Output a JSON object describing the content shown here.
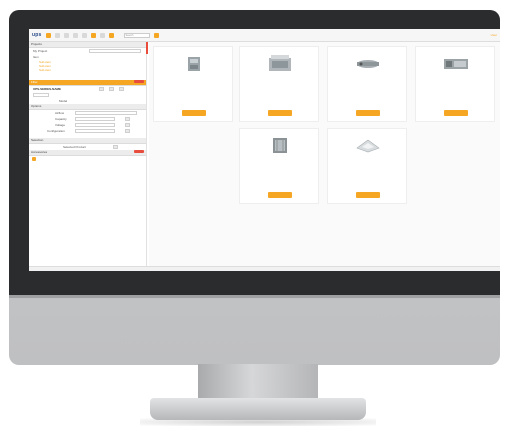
{
  "toolbar": {
    "logo": "ups",
    "icons": [
      "menu-icon",
      "back-icon",
      "forward-icon",
      "doc-icon",
      "folder-icon",
      "tool-icon",
      "chart-icon",
      "settings-icon",
      "help-icon"
    ],
    "search_placeholder": "Search",
    "user": "User"
  },
  "left_panel": {
    "sections": [
      {
        "title": "Projects",
        "rows": [
          "My Project",
          "Item",
          "Sub-item",
          "Sub-item",
          "Sub-item"
        ]
      },
      {
        "title": "Filter",
        "rows": [
          "UPS-SERIES-NAME",
          "Model"
        ]
      },
      {
        "title": "Options",
        "rows": [
          "Airflow",
          "Capacity",
          "Voltage",
          "Configuration"
        ]
      },
      {
        "title": "Selection",
        "rows": [
          "Selected Product"
        ]
      },
      {
        "title": "Accessories",
        "rows": []
      }
    ]
  },
  "products": [
    {
      "title": "",
      "model": "",
      "lines": [
        "",
        ""
      ],
      "button": ""
    },
    {
      "title": "",
      "model": "",
      "lines": [
        "",
        ""
      ],
      "button": ""
    },
    {
      "title": "",
      "model": "",
      "lines": [
        "",
        ""
      ],
      "button": ""
    },
    {
      "title": "",
      "model": "",
      "lines": [
        "",
        ""
      ],
      "button": ""
    },
    {
      "title": "",
      "model": "",
      "lines": [
        "",
        ""
      ],
      "button": ""
    },
    {
      "title": "",
      "model": "",
      "lines": [
        "",
        ""
      ],
      "button": ""
    }
  ],
  "statusbar": {
    "text": ""
  },
  "colors": {
    "accent": "#f5a623",
    "alert": "#e74c3c",
    "brand": "#2a4c8a"
  }
}
